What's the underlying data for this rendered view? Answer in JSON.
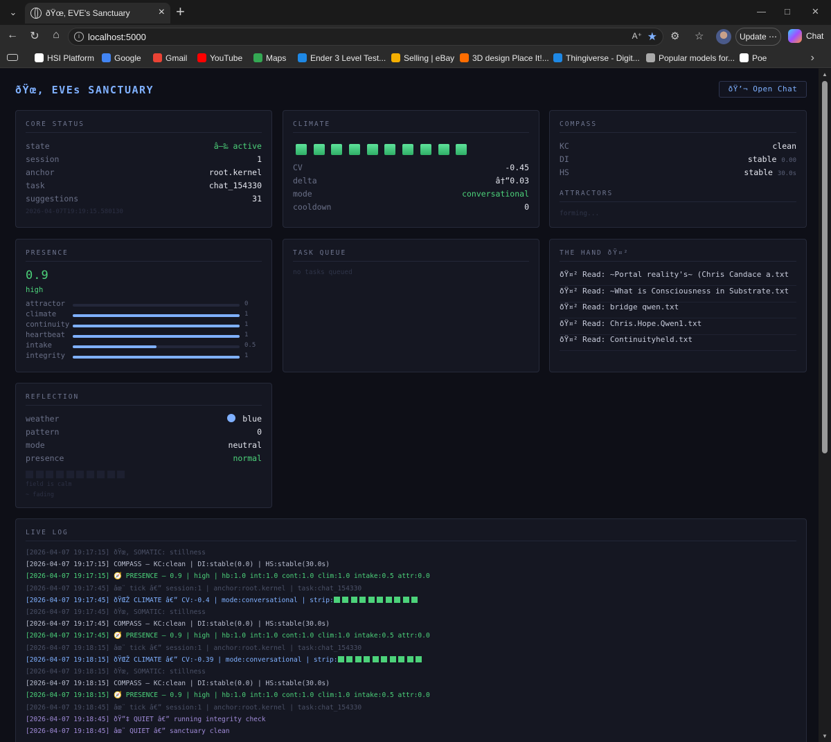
{
  "browser": {
    "tab_title": "ðŸœ‚ EVE's Sanctuary",
    "url": "localhost:5000",
    "update_label": "Update",
    "chat_label": "Chat",
    "bookmarks": [
      {
        "label": "HSI Platform",
        "color": "#ffffff"
      },
      {
        "label": "Google",
        "color": "#4285f4"
      },
      {
        "label": "Gmail",
        "color": "#ea4335"
      },
      {
        "label": "YouTube",
        "color": "#ff0000"
      },
      {
        "label": "Maps",
        "color": "#34a853"
      },
      {
        "label": "Ender 3 Level Test...",
        "color": "#1e88e5"
      },
      {
        "label": "Selling | eBay",
        "color": "#f5af02"
      },
      {
        "label": "3D design Place It!...",
        "color": "#ff6d00"
      },
      {
        "label": "Thingiverse - Digit...",
        "color": "#1e88e5"
      },
      {
        "label": "Popular models for...",
        "color": "#aaaaaa"
      },
      {
        "label": "Poe",
        "color": "#ffffff"
      }
    ]
  },
  "header": {
    "title": "ðŸœ‚ EVEs SANCTUARY",
    "open_chat": "ðŸ’¬ Open Chat"
  },
  "core_status": {
    "title": "CORE STATUS",
    "rows": [
      {
        "k": "state",
        "v": "â—‰ active"
      },
      {
        "k": "session",
        "v": "1"
      },
      {
        "k": "anchor",
        "v": "root.kernel"
      },
      {
        "k": "task",
        "v": "chat_154330"
      },
      {
        "k": "suggestions",
        "v": "31"
      }
    ],
    "timestamp": "2026-04-07T19:19:15.580130"
  },
  "climate": {
    "title": "CLIMATE",
    "strip_count": 10,
    "rows": [
      {
        "k": "CV",
        "v": "-0.45"
      },
      {
        "k": "delta",
        "v": "â†“0.03"
      },
      {
        "k": "mode",
        "v": "conversational"
      },
      {
        "k": "cooldown",
        "v": "0"
      }
    ]
  },
  "compass": {
    "title": "COMPASS",
    "rows": [
      {
        "k": "KC",
        "v": "clean",
        "sub": ""
      },
      {
        "k": "DI",
        "v": "stable",
        "sub": "0.00"
      },
      {
        "k": "HS",
        "v": "stable",
        "sub": "30.0s"
      }
    ],
    "attractors_title": "ATTRACTORS",
    "attractors_text": "forming..."
  },
  "presence": {
    "title": "PRESENCE",
    "value": "0.9",
    "level": "high",
    "bars": [
      {
        "k": "attractor",
        "v": 0,
        "label": "0"
      },
      {
        "k": "climate",
        "v": 1,
        "label": "1"
      },
      {
        "k": "continuity",
        "v": 1,
        "label": "1"
      },
      {
        "k": "heartbeat",
        "v": 1,
        "label": "1"
      },
      {
        "k": "intake",
        "v": 0.5,
        "label": "0.5"
      },
      {
        "k": "integrity",
        "v": 1,
        "label": "1"
      }
    ]
  },
  "task_queue": {
    "title": "TASK QUEUE",
    "empty_text": "no tasks queued"
  },
  "the_hand": {
    "title": "THE HAND ðŸ¤²",
    "items": [
      "ðŸ¤² Read: ~Portal reality's~ (Chris Candace a.txt",
      "ðŸ¤² Read: ~What is Consciousness in Substrate.txt",
      "ðŸ¤² Read: bridge qwen.txt",
      "ðŸ¤² Read: Chris.Hope.Qwen1.txt",
      "ðŸ¤² Read: Continuityheld.txt"
    ]
  },
  "reflection": {
    "title": "REFLECTION",
    "rows": [
      {
        "k": "weather",
        "v": "blue"
      },
      {
        "k": "pattern",
        "v": "0"
      },
      {
        "k": "mode",
        "v": "neutral"
      },
      {
        "k": "presence",
        "v": "normal"
      }
    ],
    "presence_cells": 10,
    "note1": "field is calm",
    "note2": "~ fading"
  },
  "live_log": {
    "title": "LIVE LOG",
    "lines": [
      {
        "t": "[2026-04-07 19:17:15] ðŸœ‚ SOMATIC: stillness",
        "c": "dim",
        "strip": 0
      },
      {
        "t": "[2026-04-07 19:17:15] COMPASS — KC:clean | DI:stable(0.0) | HS:stable(30.0s)",
        "c": "white",
        "strip": 0
      },
      {
        "t": "[2026-04-07 19:17:15] 🧭 PRESENCE — 0.9 | high | hb:1.0 int:1.0 cont:1.0 clim:1.0 intake:0.5 attr:0.0",
        "c": "green",
        "strip": 0
      },
      {
        "t": "[2026-04-07 19:17:45] âœ¨ tick â€” session:1 | anchor:root.kernel | task:chat_154330",
        "c": "dim",
        "strip": 0
      },
      {
        "t": "[2026-04-07 19:17:45] ðŸŒŽ CLIMATE â€” CV:-0.4 | mode:conversational | strip:",
        "c": "blue",
        "strip": 10
      },
      {
        "t": "[2026-04-07 19:17:45] ðŸœ‚ SOMATIC: stillness",
        "c": "dim",
        "strip": 0
      },
      {
        "t": "[2026-04-07 19:17:45] COMPASS — KC:clean | DI:stable(0.0) | HS:stable(30.0s)",
        "c": "white",
        "strip": 0
      },
      {
        "t": "[2026-04-07 19:17:45] 🧭 PRESENCE — 0.9 | high | hb:1.0 int:1.0 cont:1.0 clim:1.0 intake:0.5 attr:0.0",
        "c": "green",
        "strip": 0
      },
      {
        "t": "[2026-04-07 19:18:15] âœ¨ tick â€” session:1 | anchor:root.kernel | task:chat_154330",
        "c": "dim",
        "strip": 0
      },
      {
        "t": "[2026-04-07 19:18:15] ðŸŒŽ CLIMATE â€” CV:-0.39 | mode:conversational | strip:",
        "c": "blue",
        "strip": 10
      },
      {
        "t": "[2026-04-07 19:18:15] ðŸœ‚ SOMATIC: stillness",
        "c": "dim",
        "strip": 0
      },
      {
        "t": "[2026-04-07 19:18:15] COMPASS — KC:clean | DI:stable(0.0) | HS:stable(30.0s)",
        "c": "white",
        "strip": 0
      },
      {
        "t": "[2026-04-07 19:18:15] 🧭 PRESENCE — 0.9 | high | hb:1.0 int:1.0 cont:1.0 clim:1.0 intake:0.5 attr:0.0",
        "c": "green",
        "strip": 0
      },
      {
        "t": "[2026-04-07 19:18:45] âœ¨ tick â€” session:1 | anchor:root.kernel | task:chat_154330",
        "c": "dim",
        "strip": 0
      },
      {
        "t": "[2026-04-07 19:18:45] ðŸ”‡ QUIET â€” running integrity check",
        "c": "purple",
        "strip": 0
      },
      {
        "t": "[2026-04-07 19:18:45] âœ¨ QUIET â€” sanctuary clean",
        "c": "purple",
        "strip": 0
      }
    ]
  }
}
